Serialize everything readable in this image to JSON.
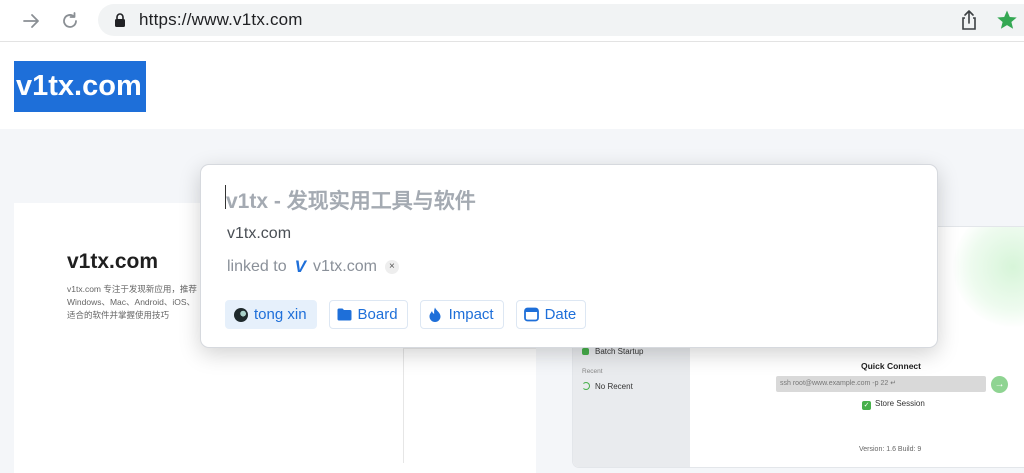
{
  "browser": {
    "url": "https://www.v1tx.com",
    "icons": {
      "back": "arrow-right-icon",
      "reload": "reload-icon",
      "lock": "lock-icon",
      "share": "share-icon",
      "bookmark": "star-icon"
    },
    "star_color": "#34a853"
  },
  "header": {
    "site_title": "v1tx.com",
    "highlight_color": "#1e6fd9"
  },
  "background_page": {
    "card_title": "v1tx.com",
    "card_desc_lines": [
      "v1tx.com 专注于发现新应用，推荐",
      "Windows、Mac、Android、iOS、",
      "适合的软件并掌握使用技巧"
    ],
    "app": {
      "batch_startup": "Batch Startup",
      "recent_label": "Recent",
      "no_recent": "No Recent",
      "quick_connect": "Quick Connect",
      "ssh_placeholder": "ssh root@www.example.com -p 22 ↵",
      "store_session": "Store Session",
      "version": "Version: 1.6 Build: 9"
    }
  },
  "popup": {
    "title": "v1tx - 发现实用工具与软件",
    "domain": "v1tx.com",
    "linked_prefix": "linked to",
    "linked_logo": "V",
    "linked_site": "v1tx.com",
    "remove_glyph": "×",
    "tags": [
      {
        "label": "tong xin",
        "icon": "avatar-icon"
      },
      {
        "label": "Board",
        "icon": "folder-icon"
      },
      {
        "label": "Impact",
        "icon": "flame-icon"
      },
      {
        "label": "Date",
        "icon": "calendar-icon"
      }
    ],
    "accent_color": "#1e6fd9"
  }
}
